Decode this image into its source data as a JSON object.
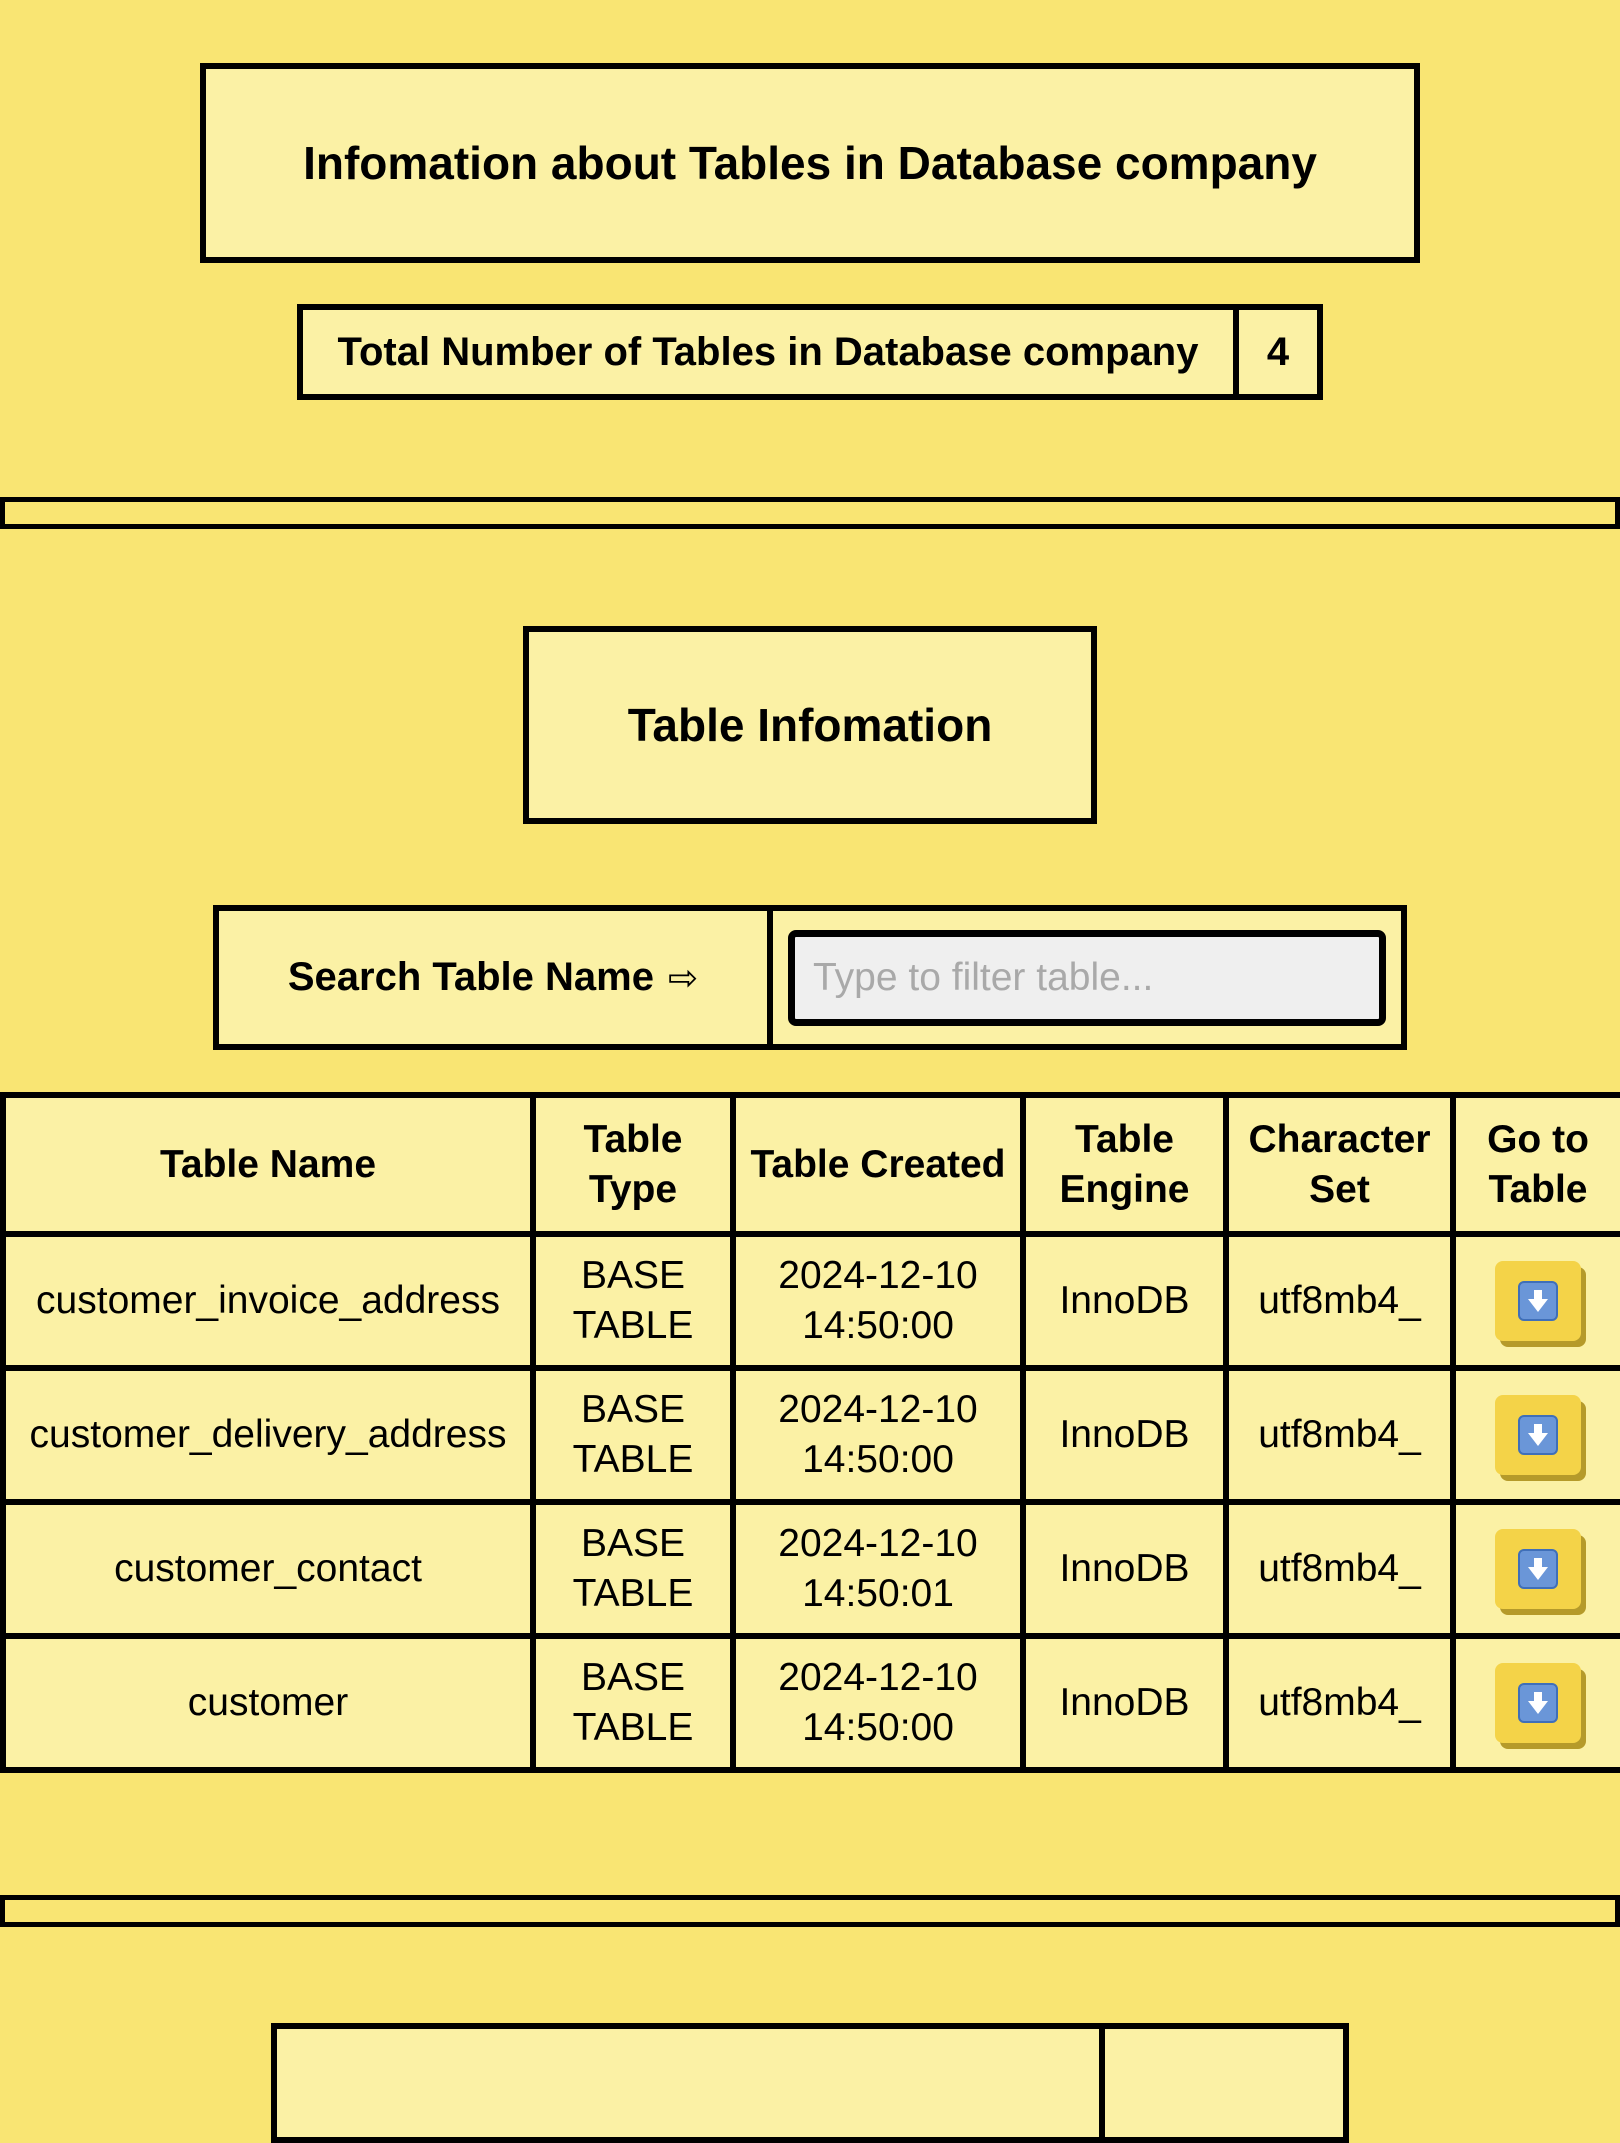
{
  "header": {
    "title": "Infomation about Tables in Database company",
    "total_label": "Total Number of Tables in Database company",
    "total_value": "4"
  },
  "section": {
    "title": "Table Infomation"
  },
  "search": {
    "label": "Search Table Name",
    "arrow_icon": "right-arrow-icon",
    "placeholder": "Type to filter table..."
  },
  "table": {
    "headers": {
      "name": "Table Name",
      "type": "Table Type",
      "created": "Table Created",
      "engine": "Table Engine",
      "charset": "Character Set",
      "go": "Go to Table"
    },
    "rows": [
      {
        "name": "customer_invoice_address",
        "type": "BASE TABLE",
        "created": "2024-12-10 14:50:00",
        "engine": "InnoDB",
        "charset": "utf8mb4_",
        "go_icon": "down-arrow-icon"
      },
      {
        "name": "customer_delivery_address",
        "type": "BASE TABLE",
        "created": "2024-12-10 14:50:00",
        "engine": "InnoDB",
        "charset": "utf8mb4_",
        "go_icon": "down-arrow-icon"
      },
      {
        "name": "customer_contact",
        "type": "BASE TABLE",
        "created": "2024-12-10 14:50:01",
        "engine": "InnoDB",
        "charset": "utf8mb4_",
        "go_icon": "down-arrow-icon"
      },
      {
        "name": "customer",
        "type": "BASE TABLE",
        "created": "2024-12-10 14:50:00",
        "engine": "InnoDB",
        "charset": "utf8mb4_",
        "go_icon": "down-arrow-icon"
      }
    ]
  },
  "colors": {
    "background": "#f9e573",
    "panel": "#fbf1a5",
    "button": "#f4d348",
    "icon": "#6a96d8"
  }
}
